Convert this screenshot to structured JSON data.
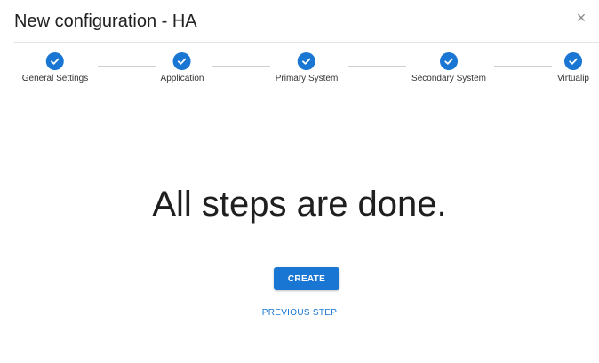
{
  "dialog": {
    "title": "New configuration - HA",
    "close_glyph": "×"
  },
  "stepper": {
    "accent_color": "#1976d2",
    "steps": [
      {
        "label": "General Settings",
        "status": "completed",
        "icon": "check-icon"
      },
      {
        "label": "Application",
        "status": "completed",
        "icon": "check-icon"
      },
      {
        "label": "Primary System",
        "status": "completed",
        "icon": "check-icon"
      },
      {
        "label": "Secondary System",
        "status": "completed",
        "icon": "check-icon"
      },
      {
        "label": "Virtualip",
        "status": "completed",
        "icon": "check-icon"
      }
    ]
  },
  "main": {
    "message": "All steps are done.",
    "create_label": "CREATE",
    "previous_label": "PREVIOUS STEP"
  }
}
